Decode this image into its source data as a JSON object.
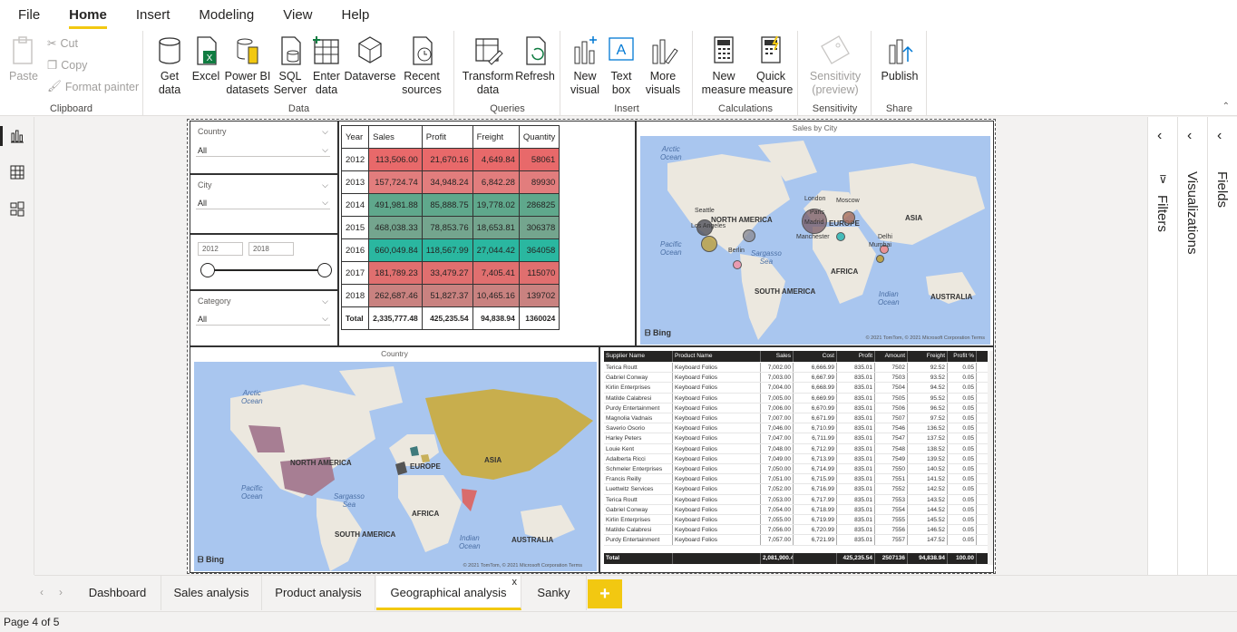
{
  "menu": {
    "file": "File",
    "home": "Home",
    "insert": "Insert",
    "modeling": "Modeling",
    "view": "View",
    "help": "Help"
  },
  "ribbon": {
    "clipboard": {
      "label": "Clipboard",
      "paste": "Paste",
      "cut": "Cut",
      "copy": "Copy",
      "format_painter": "Format painter"
    },
    "data": {
      "label": "Data",
      "get_data_1": "Get",
      "get_data_2": "data",
      "excel": "Excel",
      "pbi_1": "Power BI",
      "pbi_2": "datasets",
      "sql_1": "SQL",
      "sql_2": "Server",
      "enter_1": "Enter",
      "enter_2": "data",
      "dataverse": "Dataverse",
      "recent_1": "Recent",
      "recent_2": "sources"
    },
    "queries": {
      "label": "Queries",
      "transform_1": "Transform",
      "transform_2": "data",
      "refresh": "Refresh"
    },
    "insert": {
      "label": "Insert",
      "new_visual_1": "New",
      "new_visual_2": "visual",
      "text_box_1": "Text",
      "text_box_2": "box",
      "more_visuals_1": "More",
      "more_visuals_2": "visuals"
    },
    "calculations": {
      "label": "Calculations",
      "new_measure_1": "New",
      "new_measure_2": "measure",
      "quick_measure_1": "Quick",
      "quick_measure_2": "measure"
    },
    "sensitivity": {
      "label": "Sensitivity",
      "btn_1": "Sensitivity",
      "btn_2": "(preview)"
    },
    "share": {
      "label": "Share",
      "publish": "Publish"
    }
  },
  "slicers": {
    "country": {
      "label": "Country",
      "value": "All"
    },
    "city": {
      "label": "City",
      "value": "All"
    },
    "year": {
      "from": "2012",
      "to": "2018"
    },
    "category": {
      "label": "Category",
      "value": "All"
    }
  },
  "matrix": {
    "headers": [
      "Year",
      "Sales",
      "Profit",
      "Freight",
      "Quantity"
    ],
    "rows": [
      [
        "2012",
        "113,506.00",
        "21,670.16",
        "4,649.84",
        "58061"
      ],
      [
        "2013",
        "157,724.74",
        "34,948.24",
        "6,842.28",
        "89930"
      ],
      [
        "2014",
        "491,981.88",
        "85,888.75",
        "19,778.02",
        "286825"
      ],
      [
        "2015",
        "468,038.33",
        "78,853.76",
        "18,653.81",
        "306378"
      ],
      [
        "2016",
        "660,049.84",
        "118,567.99",
        "27,044.42",
        "364058"
      ],
      [
        "2017",
        "181,789.23",
        "33,479.27",
        "7,405.41",
        "115070"
      ],
      [
        "2018",
        "262,687.46",
        "51,827.37",
        "10,465.16",
        "139702"
      ]
    ],
    "total": [
      "Total",
      "2,335,777.48",
      "425,235.54",
      "94,838.94",
      "1360024"
    ],
    "row_colors": [
      "#e8696a",
      "#e27d7d",
      "#5fa88c",
      "#74a58e",
      "#2ab7a0",
      "#e06f6f",
      "#c98280"
    ]
  },
  "map_city": {
    "title": "Sales by City",
    "labels": {
      "na": "NORTH AMERICA",
      "eu": "EUROPE",
      "asia": "ASIA",
      "africa": "AFRICA",
      "sa": "SOUTH AMERICA",
      "aus": "AUSTRALIA"
    },
    "oceans": {
      "arctic_1": "Arctic",
      "arctic_2": "Ocean",
      "pacific_1": "Pacific",
      "pacific_2": "Ocean",
      "sargasso_1": "Sargasso",
      "sargasso_2": "Sea",
      "indian_1": "Indian",
      "indian_2": "Ocean"
    },
    "cities": {
      "seattle": "Seattle",
      "la": "Los Angeles",
      "berlin": "Berlin",
      "london": "London",
      "moscow": "Moscow",
      "paris": "Paris",
      "madrid": "Madrid",
      "manchester": "Manchester",
      "delhi": "Delhi",
      "mumbai": "Mumbai"
    },
    "bing": "Bing",
    "copyright": "© 2021 TomTom, © 2021 Microsoft Corporation  Terms"
  },
  "map_country": {
    "title": "Country",
    "labels": {
      "na": "NORTH AMERICA",
      "eu": "EUROPE",
      "asia": "ASIA",
      "africa": "AFRICA",
      "sa": "SOUTH AMERICA",
      "aus": "AUSTRALIA"
    },
    "oceans": {
      "arctic_1": "Arctic",
      "arctic_2": "Ocean",
      "pacific_1": "Pacific",
      "pacific_2": "Ocean",
      "sargasso_1": "Sargasso",
      "sargasso_2": "Sea",
      "indian_1": "Indian",
      "indian_2": "Ocean"
    },
    "bing": "Bing",
    "copyright": "© 2021 TomTom, © 2021 Microsoft Corporation  Terms"
  },
  "table": {
    "headers": [
      "Supplier Name",
      "Product Name",
      "Sales",
      "Cost",
      "Profit",
      "Amount",
      "Freight",
      "Profit %"
    ],
    "rows": [
      [
        "Terica Routt",
        "Keyboard Folios",
        "7,002.00",
        "6,666.99",
        "835.01",
        "7502",
        "92.52",
        "0.05"
      ],
      [
        "Gabriel Conway",
        "Keyboard Folios",
        "7,003.00",
        "6,667.99",
        "835.01",
        "7503",
        "93.52",
        "0.05"
      ],
      [
        "Kirlin Enterprises",
        "Keyboard Folios",
        "7,004.00",
        "6,668.99",
        "835.01",
        "7504",
        "94.52",
        "0.05"
      ],
      [
        "Matilde Calabresi",
        "Keyboard Folios",
        "7,005.00",
        "6,669.99",
        "835.01",
        "7505",
        "95.52",
        "0.05"
      ],
      [
        "Purdy Entertainment",
        "Keyboard Folios",
        "7,006.00",
        "6,670.99",
        "835.01",
        "7506",
        "96.52",
        "0.05"
      ],
      [
        "Magnolia Vadnais",
        "Keyboard Folios",
        "7,007.00",
        "6,671.99",
        "835.01",
        "7507",
        "97.52",
        "0.05"
      ],
      [
        "Saverio Osorio",
        "Keyboard Folios",
        "7,046.00",
        "6,710.99",
        "835.01",
        "7546",
        "136.52",
        "0.05"
      ],
      [
        "Harley Peters",
        "Keyboard Folios",
        "7,047.00",
        "6,711.99",
        "835.01",
        "7547",
        "137.52",
        "0.05"
      ],
      [
        "Louie Kent",
        "Keyboard Folios",
        "7,048.00",
        "6,712.99",
        "835.01",
        "7548",
        "138.52",
        "0.05"
      ],
      [
        "Adalberta Ricci",
        "Keyboard Folios",
        "7,049.00",
        "6,713.99",
        "835.01",
        "7549",
        "139.52",
        "0.05"
      ],
      [
        "Schmeler Enterprises",
        "Keyboard Folios",
        "7,050.00",
        "6,714.99",
        "835.01",
        "7550",
        "140.52",
        "0.05"
      ],
      [
        "Francis Reilly",
        "Keyboard Folios",
        "7,051.00",
        "6,715.99",
        "835.01",
        "7551",
        "141.52",
        "0.05"
      ],
      [
        "Luettwitz Services",
        "Keyboard Folios",
        "7,052.00",
        "6,716.99",
        "835.01",
        "7552",
        "142.52",
        "0.05"
      ],
      [
        "Terica Routt",
        "Keyboard Folios",
        "7,053.00",
        "6,717.99",
        "835.01",
        "7553",
        "143.52",
        "0.05"
      ],
      [
        "Gabriel Conway",
        "Keyboard Folios",
        "7,054.00",
        "6,718.99",
        "835.01",
        "7554",
        "144.52",
        "0.05"
      ],
      [
        "Kirlin Enterprises",
        "Keyboard Folios",
        "7,055.00",
        "6,719.99",
        "835.01",
        "7555",
        "145.52",
        "0.05"
      ],
      [
        "Matilde Calabresi",
        "Keyboard Folios",
        "7,056.00",
        "6,720.99",
        "835.01",
        "7556",
        "146.52",
        "0.05"
      ],
      [
        "Purdy Entertainment",
        "Keyboard Folios",
        "7,057.00",
        "6,721.99",
        "835.01",
        "7557",
        "147.52",
        "0.05"
      ]
    ],
    "total": [
      "Total",
      "",
      "2,081,900.46",
      "",
      "425,235.54",
      "2507136",
      "94,838.94",
      "100.00"
    ]
  },
  "panes": {
    "filters": "Filters",
    "visualizations": "Visualizations",
    "fields": "Fields"
  },
  "tabs": [
    "Dashboard",
    "Sales analysis",
    "Product analysis",
    "Geographical analysis",
    "Sanky"
  ],
  "add_tab": "+",
  "close_tab": "x",
  "status": "Page 4 of 5",
  "colors": {
    "accent": "#f2c811",
    "land": "#ece8df",
    "water": "#a9c6ef"
  }
}
